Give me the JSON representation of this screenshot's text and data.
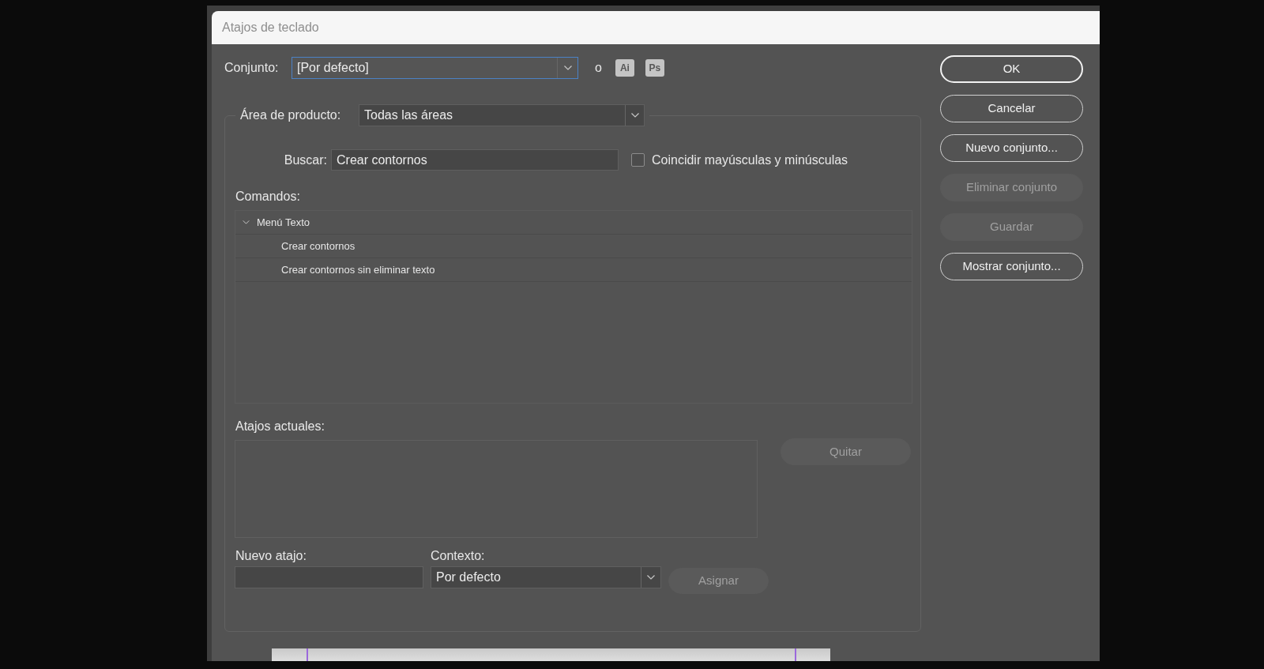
{
  "window": {
    "title": "Atajos de teclado"
  },
  "set": {
    "label": "Conjunto:",
    "value": "[Por defecto]",
    "focused": true,
    "separator": "o",
    "app_badges": [
      "Ai",
      "Ps"
    ]
  },
  "product_area": {
    "label": "Área de producto:",
    "value": "Todas las áreas"
  },
  "search": {
    "label": "Buscar:",
    "value": "Crear contornos"
  },
  "match_case": {
    "label": "Coincidir mayúsculas y minúsculas",
    "checked": false
  },
  "commands": {
    "label": "Comandos:",
    "tree": [
      {
        "label": "Menú Texto",
        "expanded": true,
        "selected": false,
        "children": [
          {
            "label": "Crear contornos",
            "selected": false
          },
          {
            "label": "Crear contornos sin eliminar texto",
            "selected": false
          }
        ]
      }
    ]
  },
  "current_shortcuts": {
    "label": "Atajos actuales:",
    "remove_button": {
      "label": "Quitar",
      "disabled": true
    }
  },
  "new_shortcut": {
    "label": "Nuevo atajo:"
  },
  "context": {
    "label": "Contexto:",
    "value": "Por defecto"
  },
  "assign_button": {
    "label": "Asignar",
    "disabled": true
  },
  "buttons": [
    {
      "label": "OK",
      "default": true,
      "disabled": false
    },
    {
      "label": "Cancelar",
      "default": false,
      "disabled": false
    },
    {
      "label": "Nuevo conjunto...",
      "default": false,
      "disabled": false
    },
    {
      "label": "Eliminar conjunto",
      "default": false,
      "disabled": true
    },
    {
      "label": "Guardar",
      "default": false,
      "disabled": true
    },
    {
      "label": "Mostrar conjunto...",
      "default": false,
      "disabled": false
    }
  ]
}
